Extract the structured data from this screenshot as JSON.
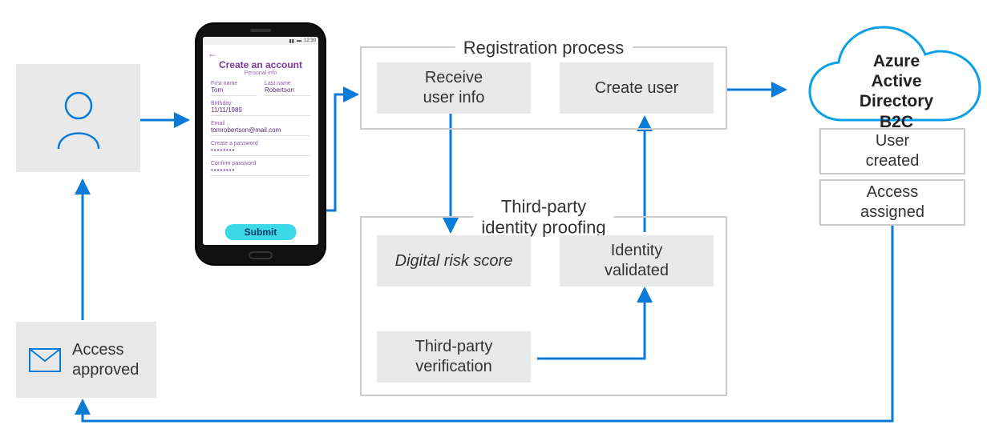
{
  "userBox": "",
  "accessApproved": "Access\napproved",
  "registration": {
    "title": "Registration process",
    "receive": "Receive\nuser info",
    "createUser": "Create user"
  },
  "proofing": {
    "title": "Third-party\nidentity proofing",
    "digitalRisk": "Digital risk score",
    "identityValidated": "Identity\nvalidated",
    "thirdPartyVerification": "Third-party\nverification"
  },
  "azure": {
    "title": "Azure\nActive Directory\nB2C",
    "userCreated": "User\ncreated",
    "accessAssigned": "Access\nassigned"
  },
  "phone": {
    "time": "12:30",
    "createAccount": "Create an account",
    "personalInfo": "Personal info",
    "firstNameLabel": "First name",
    "firstName": "Tom",
    "lastNameLabel": "Last name",
    "lastName": "Robertson",
    "birthdayLabel": "Birthday",
    "birthday": "11/11/1989",
    "emailLabel": "Email",
    "email": "tomrobertson@mail.com",
    "createPwLabel": "Create a password",
    "createPw": "••••••••",
    "confirmPwLabel": "Confirm password",
    "confirmPw": "••••••••",
    "submit": "Submit"
  }
}
